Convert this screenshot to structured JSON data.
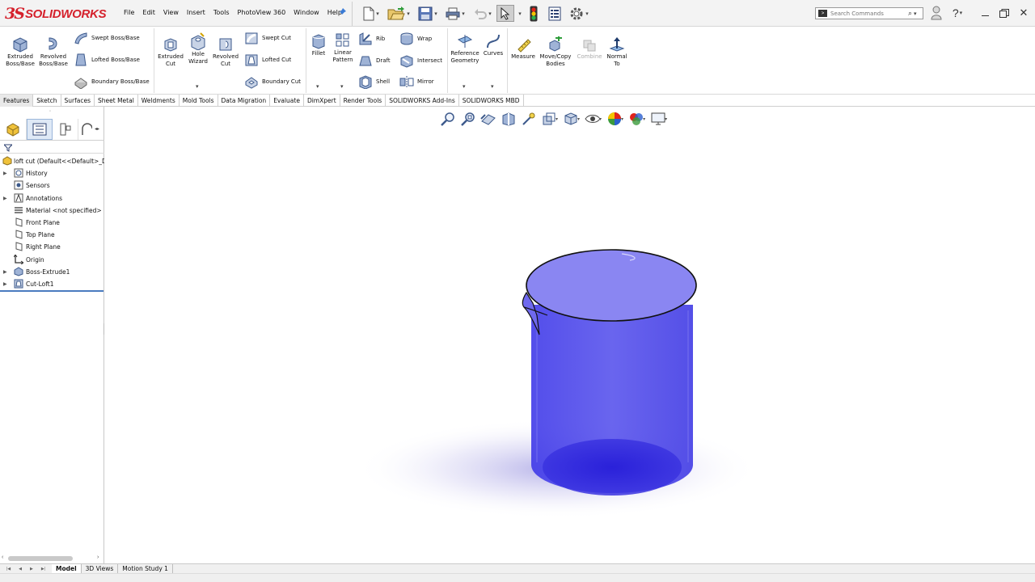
{
  "app": {
    "logo_prefix": "3S",
    "logo_text": "SOLIDWORKS"
  },
  "menu": [
    "File",
    "Edit",
    "View",
    "Insert",
    "Tools",
    "PhotoView 360",
    "Window",
    "Help"
  ],
  "search": {
    "placeholder": "Search Commands"
  },
  "ribbon": {
    "extruded_boss": "Extruded\nBoss/Base",
    "revolved_boss": "Revolved\nBoss/Base",
    "swept_boss": "Swept Boss/Base",
    "lofted_boss": "Lofted Boss/Base",
    "boundary_boss": "Boundary Boss/Base",
    "extruded_cut": "Extruded\nCut",
    "hole_wizard": "Hole\nWizard",
    "revolved_cut": "Revolved\nCut",
    "swept_cut": "Swept Cut",
    "lofted_cut": "Lofted Cut",
    "boundary_cut": "Boundary Cut",
    "fillet": "Fillet",
    "linear_pattern": "Linear\nPattern",
    "rib": "Rib",
    "draft": "Draft",
    "shell": "Shell",
    "wrap": "Wrap",
    "intersect": "Intersect",
    "mirror": "Mirror",
    "reference_geometry": "Reference\nGeometry",
    "curves": "Curves",
    "measure": "Measure",
    "move_copy": "Move/Copy\nBodies",
    "combine": "Combine",
    "normal_to": "Normal\nTo"
  },
  "tabs": [
    "Features",
    "Sketch",
    "Surfaces",
    "Sheet Metal",
    "Weldments",
    "Mold Tools",
    "Data Migration",
    "Evaluate",
    "DimXpert",
    "Render Tools",
    "SOLIDWORKS Add-Ins",
    "SOLIDWORKS MBD"
  ],
  "tree": {
    "root": "loft cut  (Default<<Default>_Di",
    "history": "History",
    "sensors": "Sensors",
    "annotations": "Annotations",
    "material": "Material <not specified>",
    "front_plane": "Front Plane",
    "top_plane": "Top Plane",
    "right_plane": "Right Plane",
    "origin": "Origin",
    "boss_extrude": "Boss-Extrude1",
    "cut_loft": "Cut-Loft1"
  },
  "bottom_tabs": [
    "Model",
    "3D Views",
    "Motion Study 1"
  ],
  "colors": {
    "part_fill": "#3a33e0",
    "part_top": "#8a86f2",
    "accent": "#d5212c"
  },
  "icons": [
    "new-document-icon",
    "open-icon",
    "save-icon",
    "print-icon",
    "undo-icon",
    "select-icon",
    "rebuild-icon",
    "file-properties-icon",
    "options-icon",
    "user-icon",
    "help-icon"
  ]
}
